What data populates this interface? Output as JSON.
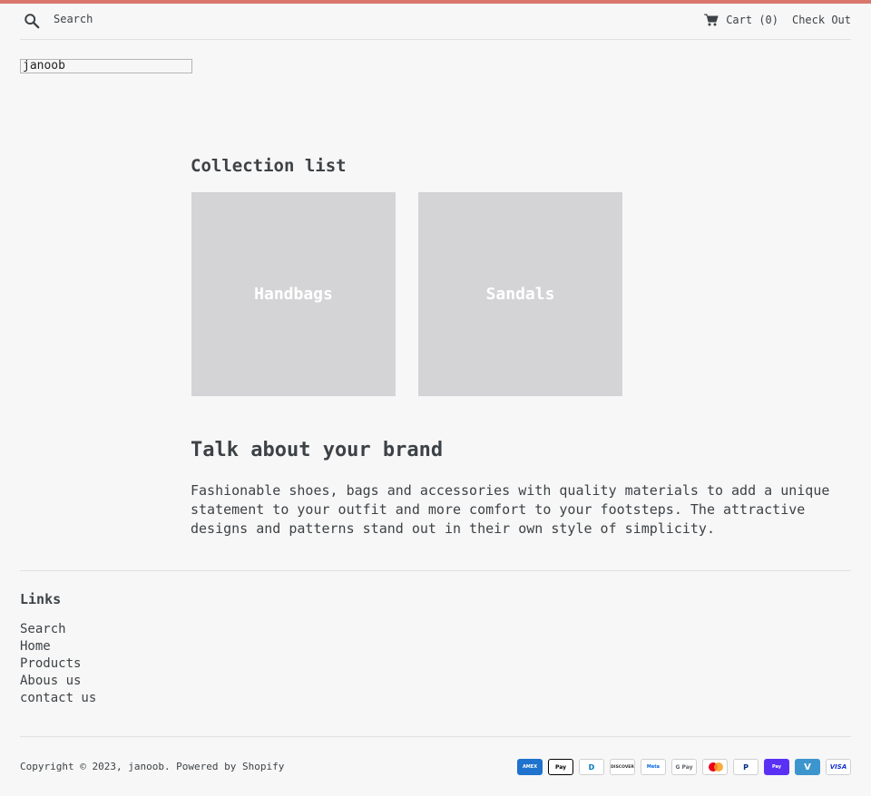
{
  "header": {
    "search_label": "Search",
    "cart_label": "Cart (0)",
    "checkout_label": "Check Out"
  },
  "logo": {
    "alt_text": "janoob"
  },
  "collection_list": {
    "title": "Collection list",
    "items": [
      {
        "label": "Handbags"
      },
      {
        "label": "Sandals"
      }
    ]
  },
  "brand": {
    "title": "Talk about your brand",
    "text": "Fashionable shoes, bags and accessories with quality materials to add a unique statement to your outfit and more comfort to your footsteps. The attractive designs and patterns stand out in their own style of simplicity."
  },
  "footer": {
    "links_title": "Links",
    "links": [
      {
        "label": "Search"
      },
      {
        "label": "Home"
      },
      {
        "label": "Products"
      },
      {
        "label": "Abous us"
      },
      {
        "label": "contact us"
      }
    ],
    "copyright": "Copyright © 2023, janoob. Powered by Shopify",
    "payment_icons": [
      {
        "name": "amex-icon",
        "text": "AMEX"
      },
      {
        "name": "apple-pay-icon",
        "text": "Pay"
      },
      {
        "name": "diners-club-icon",
        "text": "D"
      },
      {
        "name": "discover-icon",
        "text": "DISCOVER"
      },
      {
        "name": "meta-pay-icon",
        "text": "Meta"
      },
      {
        "name": "google-pay-icon",
        "text": "G Pay"
      },
      {
        "name": "mastercard-icon",
        "text": ""
      },
      {
        "name": "paypal-icon",
        "text": "P"
      },
      {
        "name": "shop-pay-icon",
        "text": "Pay"
      },
      {
        "name": "venmo-icon",
        "text": "V"
      },
      {
        "name": "visa-icon",
        "text": "VISA"
      }
    ]
  },
  "colors": {
    "accent": "#d9776c",
    "background": "#f7f7f7",
    "text": "#3d4246",
    "card_placeholder": "#d4d4d6"
  }
}
